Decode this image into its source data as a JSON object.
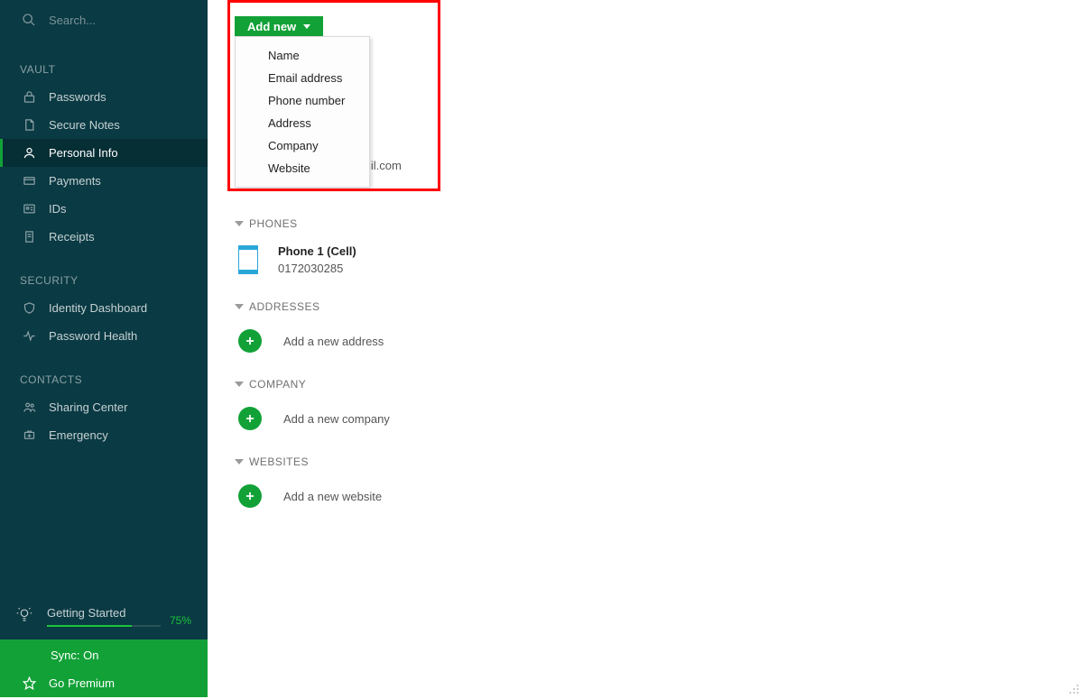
{
  "sidebar": {
    "search_placeholder": "Search...",
    "sections": {
      "vault": {
        "label": "VAULT",
        "items": [
          {
            "label": "Passwords"
          },
          {
            "label": "Secure Notes"
          },
          {
            "label": "Personal Info"
          },
          {
            "label": "Payments"
          },
          {
            "label": "IDs"
          },
          {
            "label": "Receipts"
          }
        ]
      },
      "security": {
        "label": "SECURITY",
        "items": [
          {
            "label": "Identity Dashboard"
          },
          {
            "label": "Password Health"
          }
        ]
      },
      "contacts": {
        "label": "CONTACTS",
        "items": [
          {
            "label": "Sharing Center"
          },
          {
            "label": "Emergency"
          }
        ]
      }
    },
    "getting_started": {
      "label": "Getting Started",
      "pct_text": "75%",
      "pct_value": 75
    },
    "sync_label": "Sync: On",
    "premium_label": "Go Premium"
  },
  "main": {
    "add_new_label": "Add new",
    "dropdown_items": [
      "Name",
      "Email address",
      "Phone number",
      "Address",
      "Company",
      "Website"
    ],
    "email_peek": "iil.com",
    "phones": {
      "header": "PHONES",
      "entry_title": "Phone 1 (Cell)",
      "entry_value": "0172030285"
    },
    "addresses": {
      "header": "ADDRESSES",
      "add_label": "Add a new address"
    },
    "company": {
      "header": "COMPANY",
      "add_label": "Add a new company"
    },
    "websites": {
      "header": "WEBSITES",
      "add_label": "Add a new website"
    }
  },
  "colors": {
    "sidebar_bg": "#0a3a43",
    "accent_green": "#12a137",
    "highlight_border": "#ff0000"
  }
}
